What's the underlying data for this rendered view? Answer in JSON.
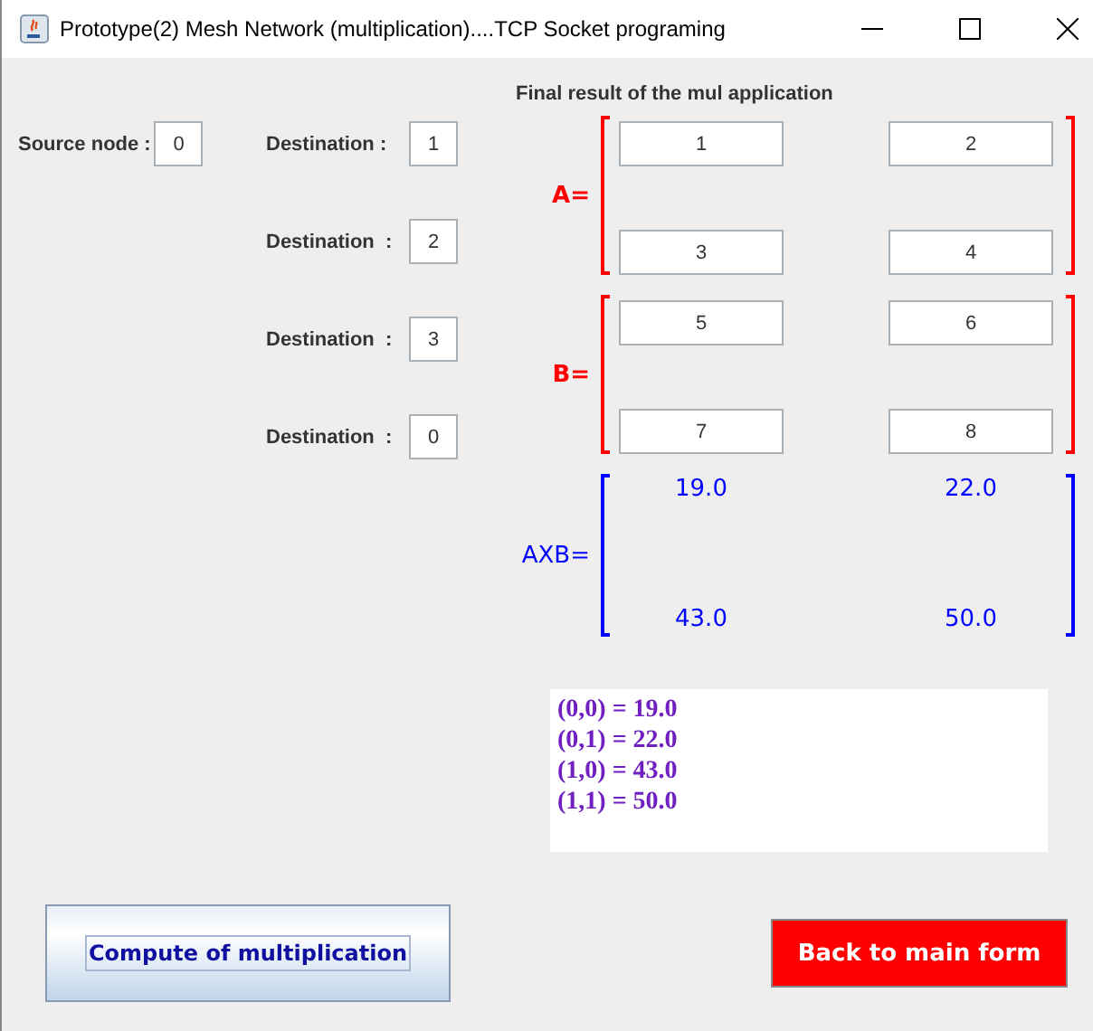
{
  "window": {
    "title": "Prototype(2) Mesh Network  (multiplication)....TCP Socket programing"
  },
  "source": {
    "label": "Source node :",
    "value": "0"
  },
  "destinations": [
    {
      "label": "Destination :",
      "value": "1"
    },
    {
      "label": "Destination  :",
      "value": "2"
    },
    {
      "label": "Destination  :",
      "value": "3"
    },
    {
      "label": "Destination  :",
      "value": "0"
    }
  ],
  "result_title": "Final result of the mul application",
  "matrices": [
    {
      "label": "A=",
      "kind": "input",
      "color": "#ff0000",
      "cells": [
        "1",
        "2",
        "3",
        "4"
      ]
    },
    {
      "label": "B=",
      "kind": "input",
      "color": "#ff0000",
      "cells": [
        "5",
        "6",
        "7",
        "8"
      ]
    },
    {
      "label": "AXB=",
      "kind": "output",
      "color": "#0000ff",
      "cells": [
        "19.0",
        "22.0",
        "43.0",
        "50.0"
      ]
    }
  ],
  "output_lines": [
    "(0,0) = 19.0",
    "(0,1) = 22.0",
    "(1,0) = 43.0",
    "(1,1) = 50.0"
  ],
  "buttons": [
    {
      "label": "Compute of multiplication",
      "kind": "gradient"
    },
    {
      "label": "Back to main form",
      "kind": "alert"
    }
  ]
}
